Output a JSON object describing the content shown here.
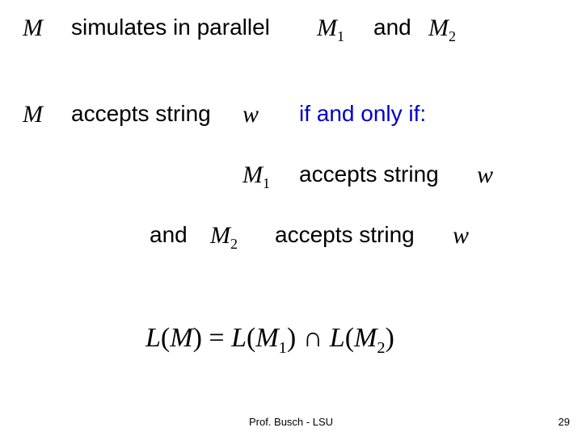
{
  "line1": {
    "m": "M",
    "t1": "simulates in parallel",
    "m1": "M",
    "and": "and",
    "m2": "M"
  },
  "line2": {
    "m": "M",
    "t1": "accepts string",
    "w": "w",
    "t2": "if and only if:"
  },
  "line3": {
    "m1": "M",
    "t": "accepts string",
    "w": "w"
  },
  "line4": {
    "and": "and",
    "m2": "M",
    "t": "accepts string",
    "w": "w"
  },
  "formula": {
    "text": "L(M) = L(M₁) ∩ L(M₂)",
    "L": "L",
    "lp": "(",
    "M": "M",
    "rp": ")",
    "eq": " = ",
    "cap": " ∩ ",
    "s1": "1",
    "s2": "2"
  },
  "footer": "Prof. Busch - LSU",
  "page": "29",
  "subs": {
    "one": "1",
    "two": "2"
  }
}
